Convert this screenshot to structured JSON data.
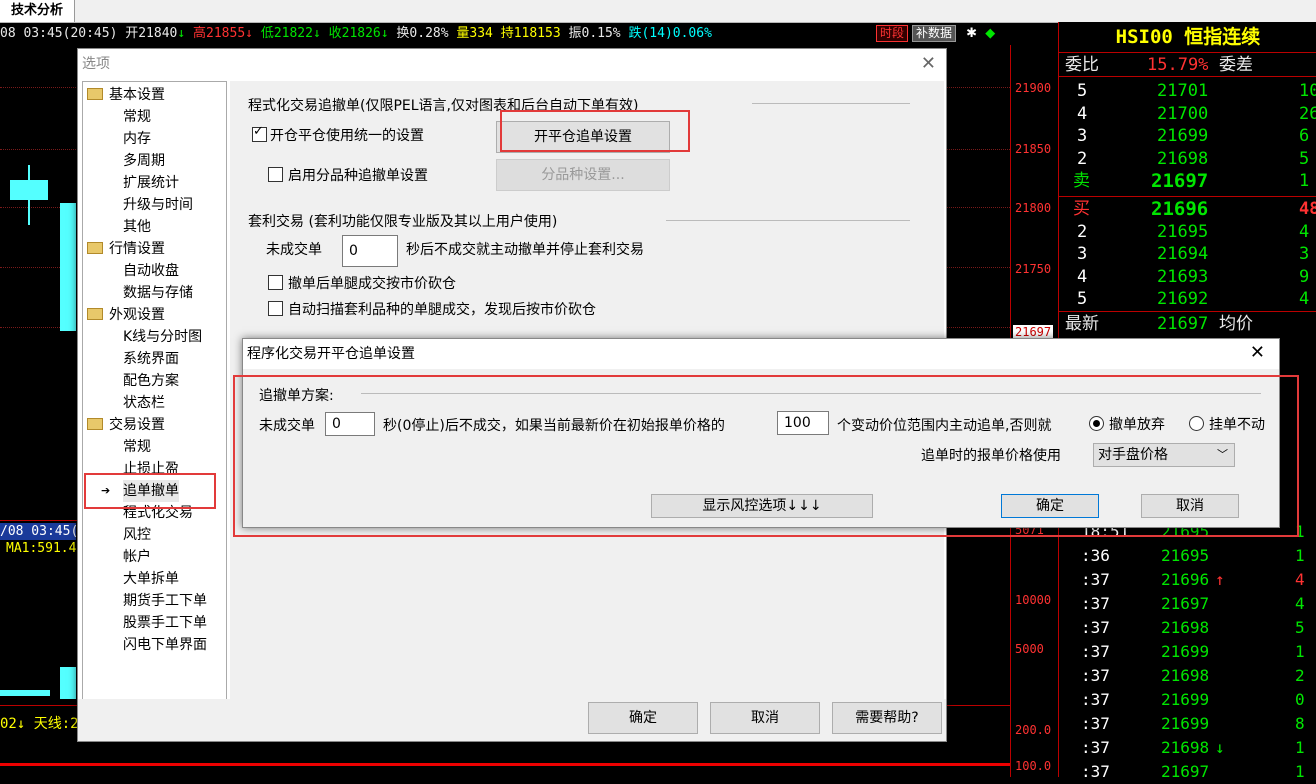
{
  "tabbar": {
    "active_tab": "技术分析"
  },
  "infobar": {
    "date": "08 03:45(20:45)",
    "open": "开21840",
    "open_arrow": "↓",
    "high": "高21855",
    "high_arrow": "↓",
    "low": "低21822",
    "low_arrow": "↓",
    "close": "收21826",
    "close_arrow": "↓",
    "turnover": "换0.28%",
    "volume": "量334",
    "hold": "持118153",
    "amplitude": "振0.15%",
    "change": "跌(14)0.06%",
    "btn_period": "时段",
    "btn_fill": "补数据"
  },
  "chart": {
    "y_labels": [
      "21900",
      "21850",
      "21800",
      "21750",
      "21697",
      "5071",
      "10000",
      "5000",
      "200.0",
      "100.0"
    ],
    "time_label": "/08 03:45(",
    "ma_label": "MA1:591.4",
    "bottom_label": "02↓ 天线:2"
  },
  "quote": {
    "title": "HSI00  恒指连续",
    "ratio_label": "委比",
    "ratio_value": "15.79%",
    "diff_label": "委差",
    "sells": [
      {
        "lv": "5",
        "price": "21701",
        "vol": "10"
      },
      {
        "lv": "4",
        "price": "21700",
        "vol": "26"
      },
      {
        "lv": "3",
        "price": "21699",
        "vol": "6"
      },
      {
        "lv": "2",
        "price": "21698",
        "vol": "5"
      },
      {
        "lv": "卖",
        "price": "21697",
        "vol": "1"
      }
    ],
    "buys": [
      {
        "lv": "买",
        "price": "21696",
        "vol": "48"
      },
      {
        "lv": "2",
        "price": "21695",
        "vol": "4"
      },
      {
        "lv": "3",
        "price": "21694",
        "vol": "3"
      },
      {
        "lv": "4",
        "price": "21693",
        "vol": "9"
      },
      {
        "lv": "5",
        "price": "21692",
        "vol": "4"
      }
    ],
    "last_label": "最新",
    "last_value": "21697",
    "avg_label": "均价",
    "ticks": [
      {
        "t": "18:51",
        "p": "21695",
        "a": "",
        "v": "1"
      },
      {
        "t": ":36",
        "p": "21695",
        "a": "",
        "v": "1"
      },
      {
        "t": ":37",
        "p": "21696",
        "a": "↑",
        "v": "4"
      },
      {
        "t": ":37",
        "p": "21697",
        "a": "",
        "v": "4"
      },
      {
        "t": ":37",
        "p": "21698",
        "a": "",
        "v": "5"
      },
      {
        "t": ":37",
        "p": "21699",
        "a": "",
        "v": "1"
      },
      {
        "t": ":37",
        "p": "21698",
        "a": "",
        "v": "2"
      },
      {
        "t": ":37",
        "p": "21699",
        "a": "",
        "v": "0"
      },
      {
        "t": ":37",
        "p": "21699",
        "a": "",
        "v": "8"
      },
      {
        "t": ":37",
        "p": "21698",
        "a": "↓",
        "v": "1"
      },
      {
        "t": ":37",
        "p": "21697",
        "a": "",
        "v": "1"
      }
    ]
  },
  "options": {
    "title": "选项",
    "tree": [
      {
        "label": "基本设置",
        "folder": true
      },
      {
        "label": "常规",
        "folder": false
      },
      {
        "label": "内存",
        "folder": false
      },
      {
        "label": "多周期",
        "folder": false
      },
      {
        "label": "扩展统计",
        "folder": false
      },
      {
        "label": "升级与时间",
        "folder": false
      },
      {
        "label": "其他",
        "folder": false
      },
      {
        "label": "行情设置",
        "folder": true
      },
      {
        "label": "自动收盘",
        "folder": false
      },
      {
        "label": "数据与存储",
        "folder": false
      },
      {
        "label": "外观设置",
        "folder": true
      },
      {
        "label": "K线与分时图",
        "folder": false
      },
      {
        "label": "系统界面",
        "folder": false
      },
      {
        "label": "配色方案",
        "folder": false
      },
      {
        "label": "状态栏",
        "folder": false
      },
      {
        "label": "交易设置",
        "folder": true
      },
      {
        "label": "常规",
        "folder": false
      },
      {
        "label": "止损止盈",
        "folder": false
      },
      {
        "label": "追单撤单",
        "folder": false,
        "selected": true
      },
      {
        "label": "程式化交易",
        "folder": false
      },
      {
        "label": "风控",
        "folder": false
      },
      {
        "label": "帐户",
        "folder": false
      },
      {
        "label": "大单拆单",
        "folder": false
      },
      {
        "label": "期货手工下单",
        "folder": false
      },
      {
        "label": "股票手工下单",
        "folder": false
      },
      {
        "label": "闪电下单界面",
        "folder": false
      }
    ],
    "section1_title": "程式化交易追撤单(仅限PEL语言,仅对图表和后台自动下单有效)",
    "unified_label": "开仓平仓使用统一的设置",
    "unified_checked": true,
    "open_close_btn": "开平仓追单设置",
    "per_product_label": "启用分品种追撤单设置",
    "per_product_btn": "分品种设置...",
    "section2_title": "套利交易 (套利功能仅限专业版及其以上用户使用)",
    "unfilled_label": "未成交单",
    "unfilled_value": "0",
    "unfilled_suffix": "秒后不成交就主动撤单并停止套利交易",
    "opt_cancel_leg": "撤单后单腿成交按市价砍仓",
    "opt_scan_leg": "自动扫描套利品种的单腿成交，发现后按市价砍仓",
    "ok": "确定",
    "cancel": "取消",
    "help": "需要帮助?"
  },
  "sub_dialog": {
    "title": "程序化交易开平仓追单设置",
    "group_title": "追撤单方案:",
    "unfilled_label": "未成交单",
    "seconds_value": "0",
    "seconds_suffix": "秒(0停止)后不成交，如果当前最新价在初始报单价格的",
    "ticks_value": "100",
    "ticks_suffix": "个变动价位范围内主动追单,否则就",
    "radio_cancel": "撤单放弃",
    "radio_hold": "挂单不动",
    "price_label": "追单时的报单价格使用",
    "price_option": "对手盘价格",
    "show_risk_btn": "显示风控选项↓↓↓",
    "ok": "确定",
    "cancel": "取消"
  }
}
